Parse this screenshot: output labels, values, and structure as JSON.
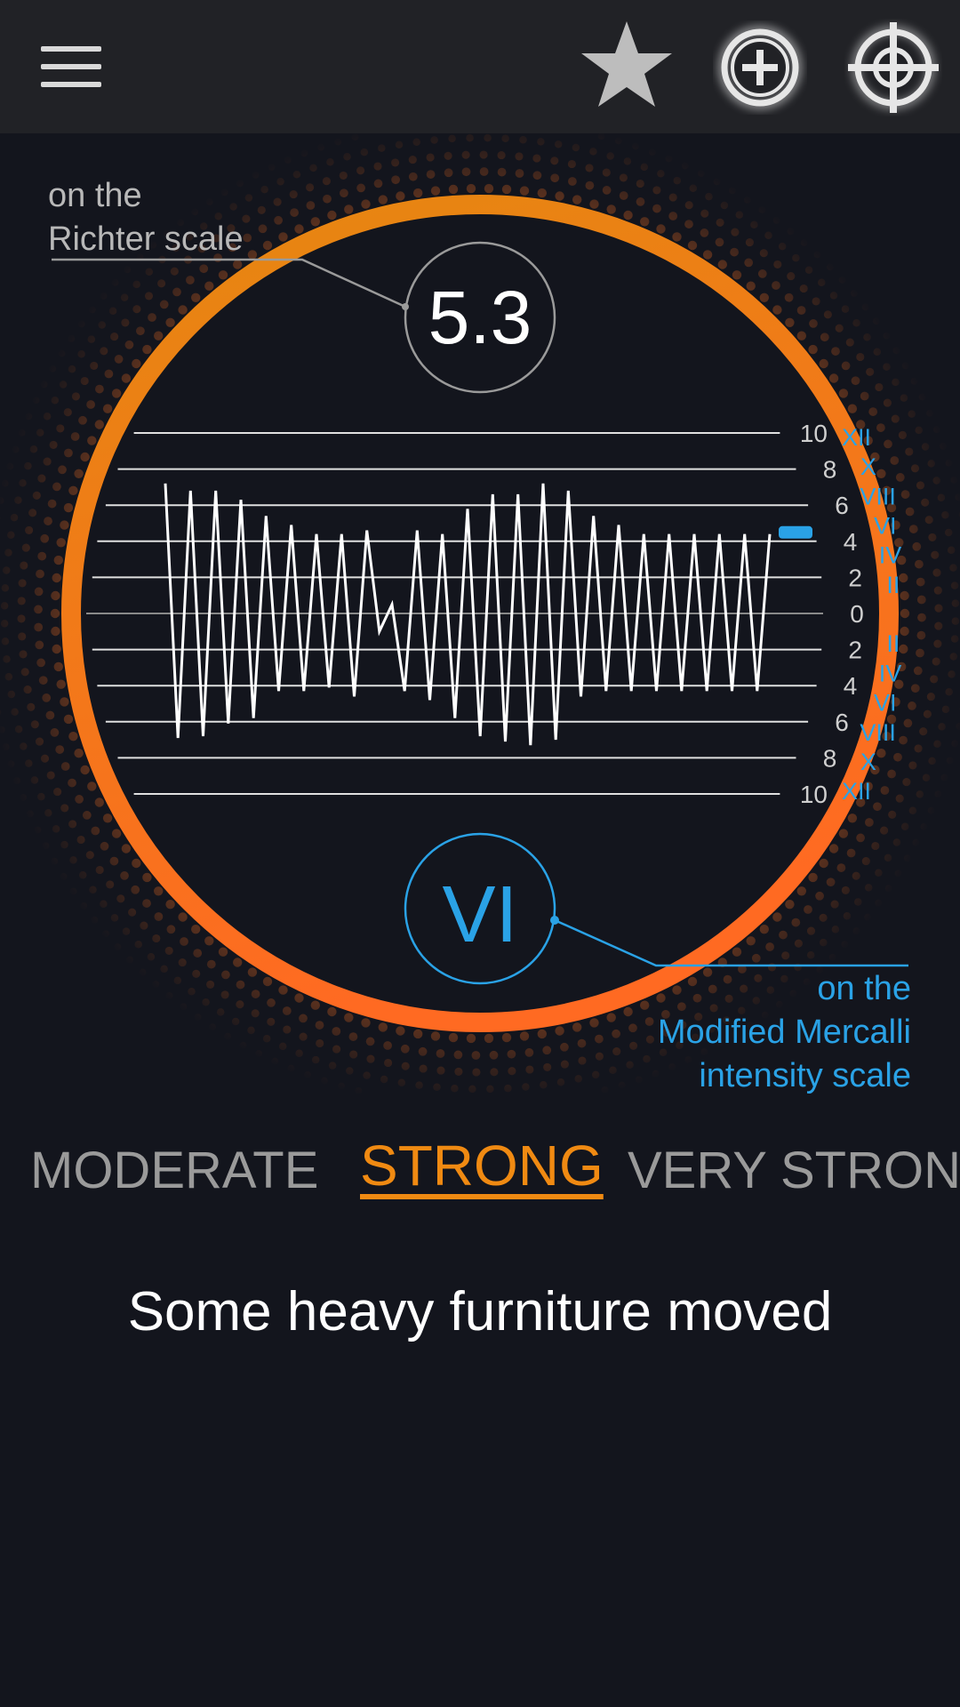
{
  "header": {
    "menu_icon": "hamburger-menu-icon",
    "favorite_icon": "star-icon",
    "add_icon": "plus-circle-icon",
    "locate_icon": "crosshair-target-icon",
    "icon_color": "#d9d9d9"
  },
  "gauge": {
    "richter_value": "5.3",
    "mercalli_value": "VI",
    "richter_caption": [
      "on the",
      "Richter scale"
    ],
    "mercalli_caption": [
      "on the",
      "Modified Mercalli",
      "intensity scale"
    ],
    "ring_color_top": "#f08a12",
    "ring_color_bottom": "#ff6a1f",
    "mercalli_color": "#2aa2e6",
    "richter_scale_labels": [
      "10",
      "8",
      "6",
      "4",
      "2",
      "0",
      "2",
      "4",
      "6",
      "8",
      "10"
    ],
    "mercalli_scale_labels": [
      "XII",
      "X",
      "VIII",
      "VI",
      "IV",
      "II",
      "",
      "II",
      "IV",
      "VI",
      "VIII",
      "X",
      "XII"
    ],
    "indicator_level": 4,
    "seismogram_peaks": [
      7.2,
      -6.9,
      6.8,
      -6.8,
      6.8,
      -6.1,
      6.3,
      -5.8,
      5.4,
      -4.3,
      4.9,
      -4.3,
      4.4,
      -4.1,
      4.4,
      -4.6,
      4.6,
      -1,
      0.5,
      -4.3,
      4.6,
      -4.8,
      4.4,
      -5.8,
      5.8,
      -6.8,
      6.6,
      -7.1,
      6.6,
      -7.3,
      7.2,
      -7,
      6.8,
      -4.6,
      5.4,
      -4.3,
      4.9,
      -4.3,
      4.4,
      -4.3,
      4.4,
      -4.3,
      4.4,
      -4.3,
      4.4,
      -4.3,
      4.4,
      -4.3,
      4.4
    ]
  },
  "categories": {
    "previous": "MODERATE",
    "current": "STRONG",
    "next": "VERY STRONG",
    "current_color": "#f08a12"
  },
  "effect": "Some heavy furniture moved"
}
